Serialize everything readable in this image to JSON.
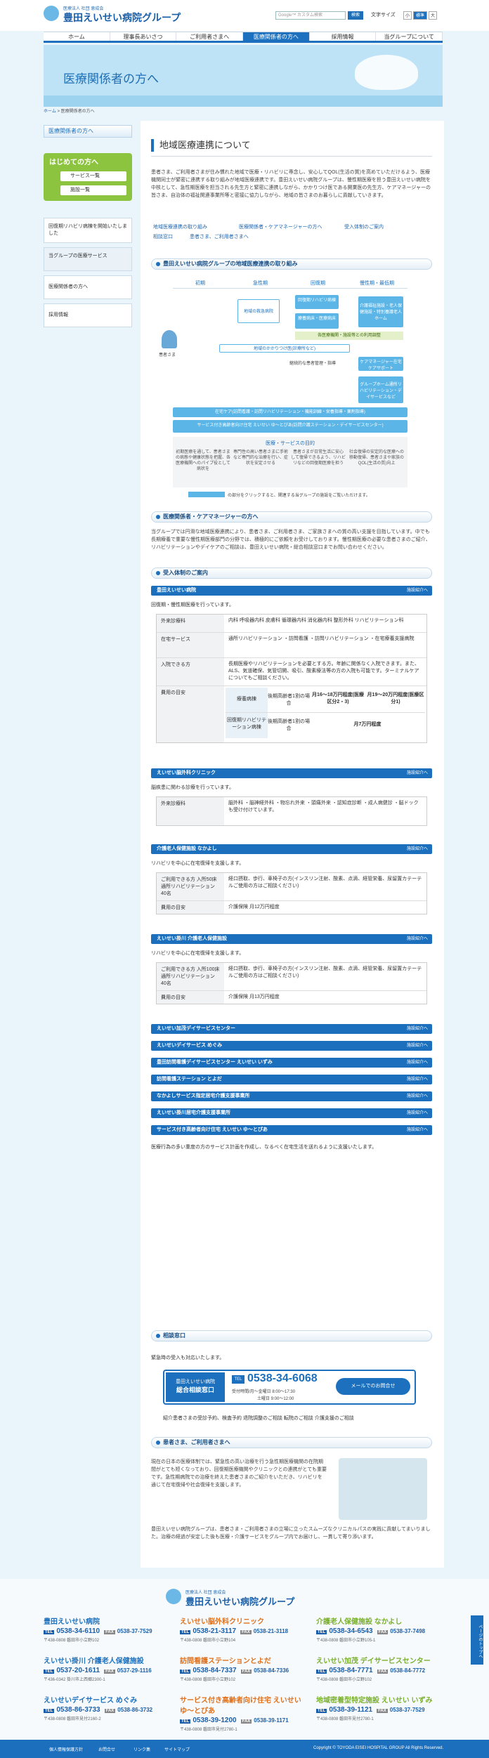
{
  "header": {
    "org_sub": "医療法人 社団 恵成会",
    "org_name": "豊田えいせい病院グループ",
    "search_placeholder": "Google™ カスタム検索",
    "search_button": "検索",
    "font_size_label": "文字サイズ",
    "font_small": "小",
    "font_std": "標準",
    "font_large": "大"
  },
  "nav": [
    "ホーム",
    "理事長あいさつ",
    "ご利用者さまへ",
    "医療関係者の方へ",
    "採用情報",
    "当グループについて"
  ],
  "banner_title": "医療関係者の方へ",
  "breadcrumb": {
    "home": "ホーム",
    "current": "医療関係者の方へ"
  },
  "sidebar": {
    "head": "医療関係者の方へ",
    "first": "はじめての方へ",
    "services": "サービス一覧",
    "facilities": "施設一覧",
    "box1": "回復期リハビリ病棟を開始いたしました",
    "box2": "当グループの医療サービス",
    "box3": "医療関係者の方へ",
    "box4": "採用情報"
  },
  "main": {
    "title": "地域医療連携について",
    "intro": "患者さま、ご利用者さまが住み慣れた地域で医療・リハビリに専念し、安心してQOL(生活の質)を高めていただけるよう、医療機関同士が緊密に連携する取り組みが地域医療連携です。豊田えいせい病院グループは、慢性期医療を担う豊田えいせい病院を中核として、急性期医療を担当される先生方と緊密に連携しながら、かかりつけ医である開業医の先生方、ケアマネージャーの皆さま、自治体の福祉関連事業所等と密接に協力しながら、地域の皆さまのお暮らしに貢献していきます。",
    "links": [
      "地域医療連携の取り組み",
      "医療関係者・ケアマネージャーの方へ",
      "受入体制のご案内",
      "相談窓口",
      "患者さま、ご利用者さまへ"
    ],
    "sec1": "豊田えいせい病院グループの地域医療連携の取り組み",
    "diagram": {
      "phases": [
        "初期",
        "急性期",
        "回復期",
        "慢性期・最低期"
      ],
      "patient": "患者さま",
      "d1": "地域の救急病院",
      "d2": "回復期リハビリ病棟",
      "d3": "療養病床・医療病床",
      "d4": "介護福祉施設・老人保健施設・特別養護老人ホーム",
      "d5": "各医療機関・施設等との利用調整",
      "d6": "地域のかかりつけ医(診療所など)",
      "d7": "ケアマネージャー在宅ケアサポート",
      "d8": "グループホーム通所リハビリテーション・デイサービスなど",
      "d9": "継続的な患者管理・指導",
      "d10": "在宅ケア(訪問看護・訪問リハビリテーション・機能訓練・栄養指導・薬剤指導)",
      "d11": "サービス付き高齢者向け住宅 えいせい ゆ〜とぴあ(訪問介護ステーション・デイサービスセンター)",
      "purpose": "医療・サービスの目的",
      "p1": "初期医療を通して、患者さまの病態や健康状態を把握、各医療機関へのパイプ役として病状を",
      "p2": "専門性の高い患者さまに手術など専門的な治療を行い、症状を安定させる",
      "p3": "患者さまが日常生活に安心して復帰できるよう、リハビリなどの回復期医療を担う",
      "p4": "社会復帰の安定的な医療への移動復帰、患者さまや家族のQOL(生活の質)向上",
      "note": "の部分をクリックすると、関連する当グループの施設をご覧いただけます。"
    },
    "sec2": "医療関係者・ケアマネージャーの方へ",
    "sec2_text": "当グループでは円滑な地域医療連携により、患者さま、ご利用者さま、ご家族さまへの質の高い支援を目指しています。中でも長期療養で重要な慢性期医療部門の分野では、積極的にご依頼をお受けしております。慢性期医療の必要な患者さまのご紹介、リハビリテーションやデイケアのご相談は、豊田えいせい病院・総合相談窓口までお問い合わせください。",
    "sec3": "受入体制のご案内",
    "detail": "施設紹介へ",
    "h_name": "豊田えいせい病院",
    "h_desc": "回復期・慢性期医療を行っています。",
    "h_rows": [
      {
        "k": "外来診療科",
        "v": "内科 呼吸器内科 皮膚科 循環器内科 消化器内科 整形外科 リハビリテーション科"
      },
      {
        "k": "在宅サービス",
        "v": "通所リハビリテーション ・訪問看護 ・訪問リハビリテーション ・在宅療養支援病院"
      },
      {
        "k": "入院できる方",
        "v": "長期医療やリハビリテーションを必要とする方。年齢に関係なく入院できます。また、ALS、気道確保、気管切開、吸引、酸素療法等の方の入院も可能です。ターミナルケアについてもご相談ください。"
      }
    ],
    "fee_label": "費用の目安",
    "fee_table": {
      "r1c1": "療養病棟",
      "r1c2": "後期高齢者1割の場合",
      "r1c3": "月16〜18万円程度(医療区分2・3)",
      "r1c4": "月19〜20万円程度(医療区分1)",
      "r2c1": "回復期リハビリテーション病棟",
      "r2c2": "後期高齢者1割の場合",
      "r2c3": "月7万円程度"
    },
    "c_name": "えいせい脳外科クリニック",
    "c_desc": "脳疾患に関わる診療を行っています。",
    "c_rows": [
      {
        "k": "外来診療科",
        "v": "脳外科 ・脳神経外科 ・物忘れ外来 ・頭痛外来 ・認知症診断 ・成人病健診 ・脳ドックも受け付けています。"
      }
    ],
    "n_name": "介護老人保健施設 なかよし",
    "n_desc": "リハビリを中心に在宅復帰を支援します。",
    "n_rows": [
      {
        "k": "ご利用できる方 入所50床 通所リハビリテーション40名",
        "v": "経口摂取、歩行、車椅子の方(インスリン注射、酸素、点滴、経管栄養、尿留置カテーテルご使用の方はご相談ください)"
      },
      {
        "k": "費用の目安",
        "v": "介護保険 月12万円程度"
      }
    ],
    "k_name": "えいせい掛川 介護老人保健施設",
    "k_desc": "リハビリを中心に在宅復帰を支援します。",
    "k_rows": [
      {
        "k": "ご利用できる方 入所100床 通所リハビリテーション40名",
        "v": "経口摂取、歩行、車椅子の方(インスリン注射、酸素、点滴、経管栄養、尿留置カテーテルご使用の方はご相談ください)"
      },
      {
        "k": "費用の目安",
        "v": "介護保険 月13万円程度"
      }
    ],
    "more_bars": [
      "えいせい加茂デイサービスセンター",
      "えいせいデイサービス めぐみ",
      "豊田訪問看護デイサービスセンター えいせい いずみ",
      "訪問看護ステーション とよだ",
      "なかよしサービス指定居宅介護支援事業所",
      "えいせい掛川居宅介護支援事業所",
      "サービス付き高齢者向け住宅 えいせい ゆ〜とぴあ"
    ],
    "more_desc": "医療行為の多い重度の方のサービス計画を作成し、なるべく在宅生活を送れるように支援いたします。",
    "sec4": "相談窓口",
    "sec4_text": "緊急時の受入も対応いたします。",
    "contact": {
      "hospital": "豊田えいせい病院",
      "window": "総合相談窓口",
      "tel": "0538-34-6068",
      "hours1": "受付時間/月〜金曜日 8:00〜17:30",
      "hours2": "土曜日 9:00〜12:00",
      "mail": "メールでのお問合せ"
    },
    "contact_note": "紹介患者さまの受診予約、検査予約 退院調整のご相談 転院のご相談 介護支援のご相談",
    "sec5": "患者さま、ご利用者さまへ",
    "sec5_text1": "現在の日本の医療体制では、緊急性の高い治療を行う急性期医療機関の在院期間がとても短くなっており、回復期医療機関やクリニックとの連携がとても重要です。急性期病院での治療を終えた患者さまのご紹介をいただき、リハビリを通じて在宅復帰や社会復帰を支援します。",
    "sec5_text2": "豊田えいせい病院グループは、患者さま・ご利用者さまの立場に立ったスムーズなクリニカルパスの実践に貢献してまいりました。治療の経過が安定した後も医療・介護サービスをグループ内でお届けし、一貫して寄り添います。"
  },
  "footer": {
    "org_sub": "医療法人 社団 恵成会",
    "org_name": "豊田えいせい病院グループ",
    "items": [
      {
        "name": "豊田えいせい病院",
        "tel": "0538-34-6110",
        "fax": "0538-37-7529",
        "addr": "〒438-0808 磐田市小立野102"
      },
      {
        "name": "えいせい脳外科クリニック",
        "tel": "0538-21-3117",
        "fax": "0538-21-3118",
        "addr": "〒438-0808 磐田市小立野104"
      },
      {
        "name": "介護老人保健施設 なかよし",
        "tel": "0538-34-6543",
        "fax": "0538-37-7498",
        "addr": "〒438-0808 磐田市小立野105-1"
      },
      {
        "name": "えいせい掛川 介護老人保健施設",
        "tel": "0537-20-1611",
        "fax": "0537-29-1116",
        "addr": "〒436-0342 掛川市上西郷2300-1"
      },
      {
        "name": "訪問看護ステーションとよだ",
        "tel": "0538-84-7337",
        "fax": "0538-84-7336",
        "addr": "〒438-0808 磐田市小立野102"
      },
      {
        "name": "えいせい加茂 デイサービスセンター",
        "tel": "0538-84-7771",
        "fax": "0538-84-7772",
        "addr": "〒438-0808 磐田市小立野102"
      },
      {
        "name": "えいせいデイサービス めぐみ",
        "tel": "0538-86-3733",
        "fax": "0538-86-3732",
        "addr": "〒438-0808 磐田市見付2160-2"
      },
      {
        "name": "サービス付き高齢者向け住宅 えいせい ゆ〜とぴあ",
        "tel": "0538-39-1200",
        "fax": "0538-39-1171",
        "addr": "〒438-0808 磐田市見付2780-1"
      },
      {
        "name": "地域密着型特定施設 えいせい いずみ",
        "tel": "0538-39-1121",
        "fax": "0538-37-7529",
        "addr": "〒438-0808 磐田市見付2780-1"
      }
    ],
    "links": [
      "個人情報保護方針",
      "お問合せ",
      "リンク集",
      "サイトマップ"
    ],
    "copyright": "Copyright © TOYODA EISEI HOSPITAL GROUP All Rights Reserved.",
    "pagetop": "ページのトップへ",
    "tel_label": "TEL",
    "fax_label": "FAX"
  },
  "colors": {
    "brand": "#1c70bd",
    "green": "#8cc43f",
    "banner": "#bfe3f6"
  }
}
